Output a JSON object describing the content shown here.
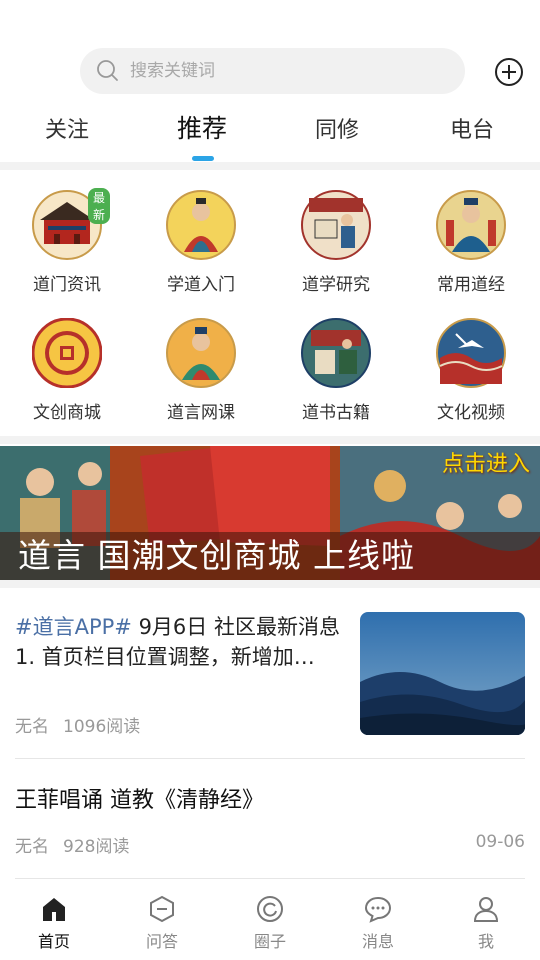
{
  "search": {
    "placeholder": "搜索关键词"
  },
  "tabs": [
    {
      "label": "关注"
    },
    {
      "label": "推荐"
    },
    {
      "label": "同修"
    },
    {
      "label": "电台"
    }
  ],
  "grid": {
    "badge_new": "最新",
    "items": [
      {
        "label": "道门资讯",
        "icon": "temple-icon"
      },
      {
        "label": "学道入门",
        "icon": "deity-icon"
      },
      {
        "label": "道学研究",
        "icon": "scholar-icon"
      },
      {
        "label": "常用道经",
        "icon": "sutra-icon"
      },
      {
        "label": "文创商城",
        "icon": "coin-icon"
      },
      {
        "label": "道言网课",
        "icon": "teacher-icon"
      },
      {
        "label": "道书古籍",
        "icon": "books-icon"
      },
      {
        "label": "文化视频",
        "icon": "crane-icon"
      }
    ]
  },
  "banner": {
    "cta": "点击进入",
    "title": "道言  国潮文创商城  上线啦"
  },
  "feed": {
    "item1": {
      "hashtag": "#道言APP#",
      "title_rest": " 9月6日 社区最新消息",
      "line2": "1. 首页栏目位置调整，新增加…",
      "author": "无名",
      "views": "1096阅读"
    },
    "item2": {
      "title": "王菲唱诵 道教《清静经》",
      "author": "无名",
      "views": "928阅读",
      "date": "09-06"
    }
  },
  "bottom_nav": [
    {
      "label": "首页",
      "icon": "home-icon"
    },
    {
      "label": "问答",
      "icon": "qa-icon"
    },
    {
      "label": "圈子",
      "icon": "circle-icon"
    },
    {
      "label": "消息",
      "icon": "message-icon"
    },
    {
      "label": "我",
      "icon": "profile-icon"
    }
  ],
  "colors": {
    "accent": "#2ba4e6",
    "hashtag": "#4a6fa5",
    "badge": "#4caf50",
    "banner_cta": "#ffd700"
  }
}
